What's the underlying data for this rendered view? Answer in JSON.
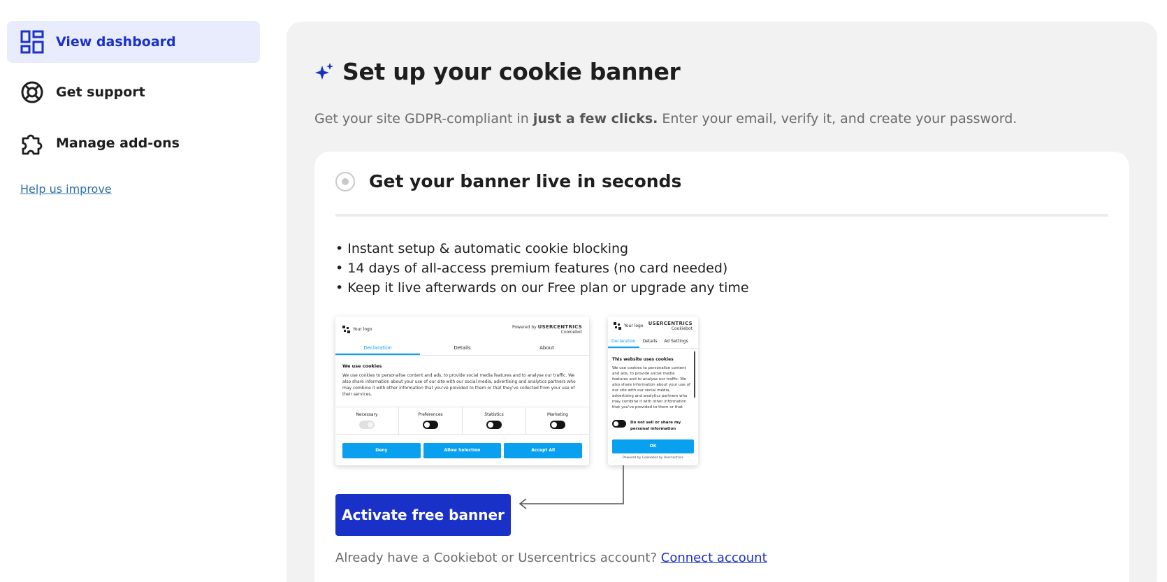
{
  "sidebar": {
    "items": [
      {
        "label": "View dashboard",
        "icon": "dashboard-icon",
        "active": true
      },
      {
        "label": "Get support",
        "icon": "lifebuoy-icon",
        "active": false
      },
      {
        "label": "Manage add-ons",
        "icon": "puzzle-icon",
        "active": false
      }
    ],
    "help_link": "Help us improve"
  },
  "main": {
    "title": "Set up your cookie banner",
    "subtitle_before": "Get your site GDPR-compliant in ",
    "subtitle_bold": "just a few clicks.",
    "subtitle_after": " Enter your email, verify it, and create your password.",
    "card": {
      "title": "Get your banner live in seconds",
      "bullets": [
        "• Instant setup & automatic cookie blocking",
        "• 14 days of all-access premium features (no card needed)",
        "• Keep it live afterwards on our Free plan or upgrade any time"
      ],
      "activate_button": "Activate free banner",
      "account_text": "Already have a Cookiebot or Usercentrics account?",
      "connect_link": "Connect account"
    }
  },
  "preview_desktop": {
    "logo": "Your logo",
    "powered_by": "Powered by",
    "brand": "USERCENTRICS",
    "brand_sub": "Cookiebot",
    "tabs": [
      "Declaration",
      "Details",
      "About"
    ],
    "heading": "We use cookies",
    "body": "We use cookies to personalise content and ads, to provide social media features and to analyse our traffic. We also share information about your use of our site with our social media, advertising and analytics partners who may combine it with other information that you've provided to them or that they've collected from your use of their services.",
    "toggles": [
      "Necessary",
      "Preferences",
      "Statistics",
      "Marketing"
    ],
    "buttons": [
      "Deny",
      "Allow Selection",
      "Accept All"
    ]
  },
  "preview_mobile": {
    "logo": "Your logo",
    "brand": "USERCENTRICS",
    "brand_sub": "Cookiebot",
    "tabs": [
      "Declaration",
      "Details",
      "Ad Settings"
    ],
    "heading": "This website uses cookies",
    "body": "We use cookies to personalise content and ads, to provide social media features and to analyse our traffic. We also share information about your use of our site with our social media, advertising and analytics partners who may combine it with other information that you've provided to them or that",
    "option": "Do not sell or share my personal information",
    "ok": "OK",
    "footer": "Powered by Cookiebot by Usercentrics"
  },
  "colors": {
    "accent": "#1a31c8",
    "active_bg": "#e8ecfd",
    "panel_bg": "#f2f2f2",
    "banner_blue": "#0aa0f0"
  }
}
